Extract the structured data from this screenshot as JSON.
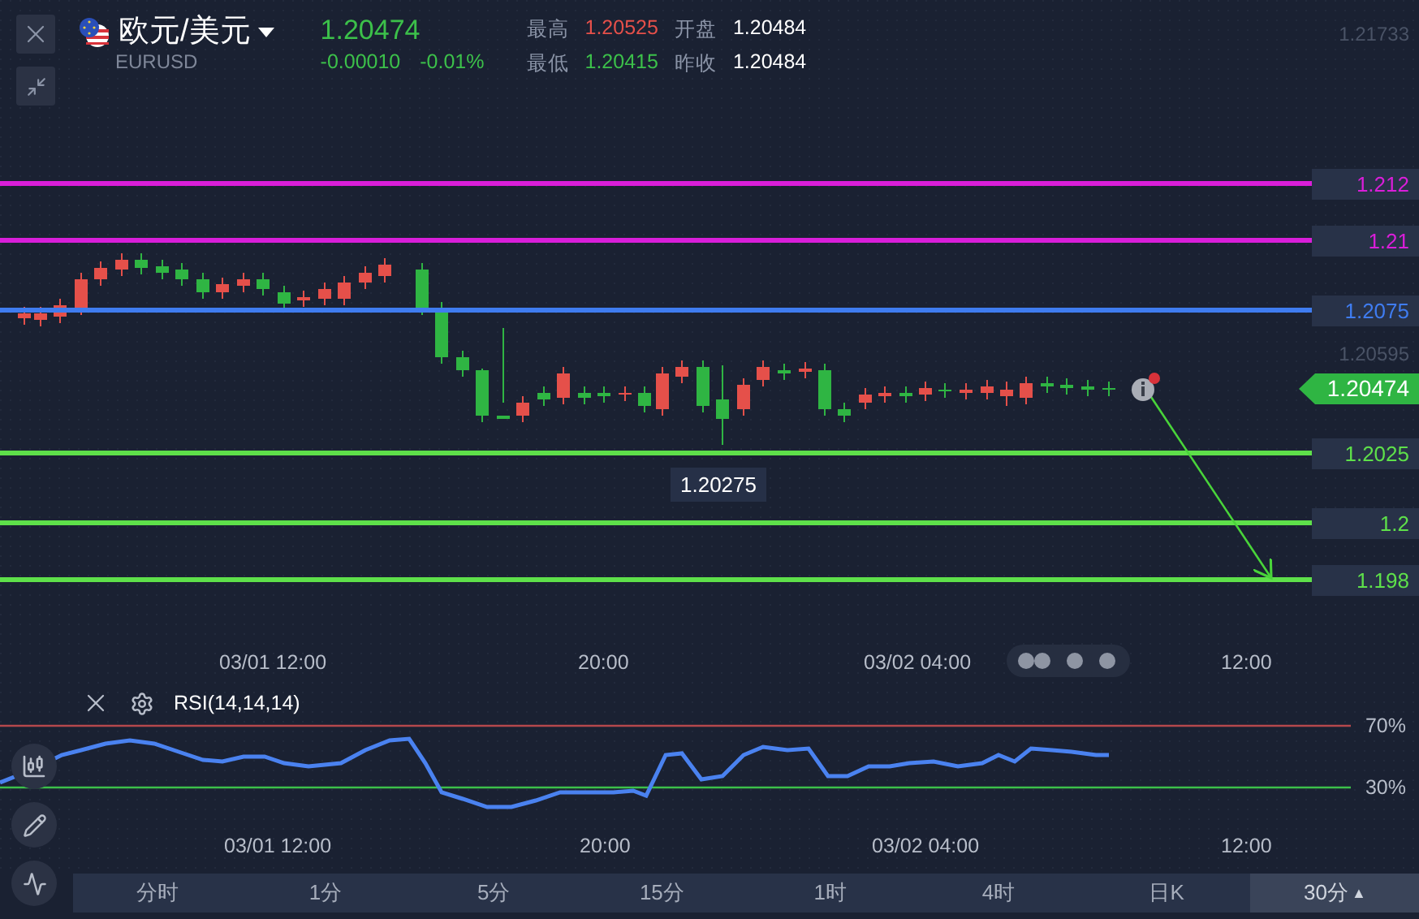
{
  "header": {
    "title": "欧元/美元",
    "symbol": "EURUSD",
    "price": "1.20474",
    "change": "-0.00010",
    "change_percent": "-0.01%",
    "stats": [
      {
        "label": "最高",
        "value": "1.20525",
        "kind": "high"
      },
      {
        "label": "开盘",
        "value": "1.20484",
        "kind": "neutral"
      },
      {
        "label": "最低",
        "value": "1.20415",
        "kind": "low"
      },
      {
        "label": "昨收",
        "value": "1.20484",
        "kind": "neutral"
      }
    ]
  },
  "chart": {
    "axis_labels": [
      "1.21733",
      "1.20595"
    ],
    "levels": [
      {
        "price": "1.212",
        "color": "#d91ed9"
      },
      {
        "price": "1.21",
        "color": "#d91ed9"
      },
      {
        "price": "1.2075",
        "color": "#3f7cf0"
      },
      {
        "price": "1.2025",
        "color": "#5ee04a"
      },
      {
        "price": "1.2",
        "color": "#5ee04a"
      },
      {
        "price": "1.198",
        "color": "#5ee04a"
      }
    ],
    "current_price": "1.20474",
    "low_marker": "1.20275",
    "time_labels": [
      "03/01 12:00",
      "20:00",
      "03/02 04:00",
      "12:00"
    ]
  },
  "indicator": {
    "name": "RSI(14,14,14)",
    "levels": [
      "70%",
      "30%"
    ],
    "time_labels": [
      "03/01 12:00",
      "20:00",
      "03/02 04:00",
      "12:00"
    ]
  },
  "timeframes": [
    {
      "label": "分时",
      "selected": false
    },
    {
      "label": "1分",
      "selected": false
    },
    {
      "label": "5分",
      "selected": false
    },
    {
      "label": "15分",
      "selected": false
    },
    {
      "label": "1时",
      "selected": false
    },
    {
      "label": "4时",
      "selected": false
    },
    {
      "label": "日K",
      "selected": false
    },
    {
      "label": "30分",
      "selected": true,
      "caret": "▲"
    }
  ]
}
